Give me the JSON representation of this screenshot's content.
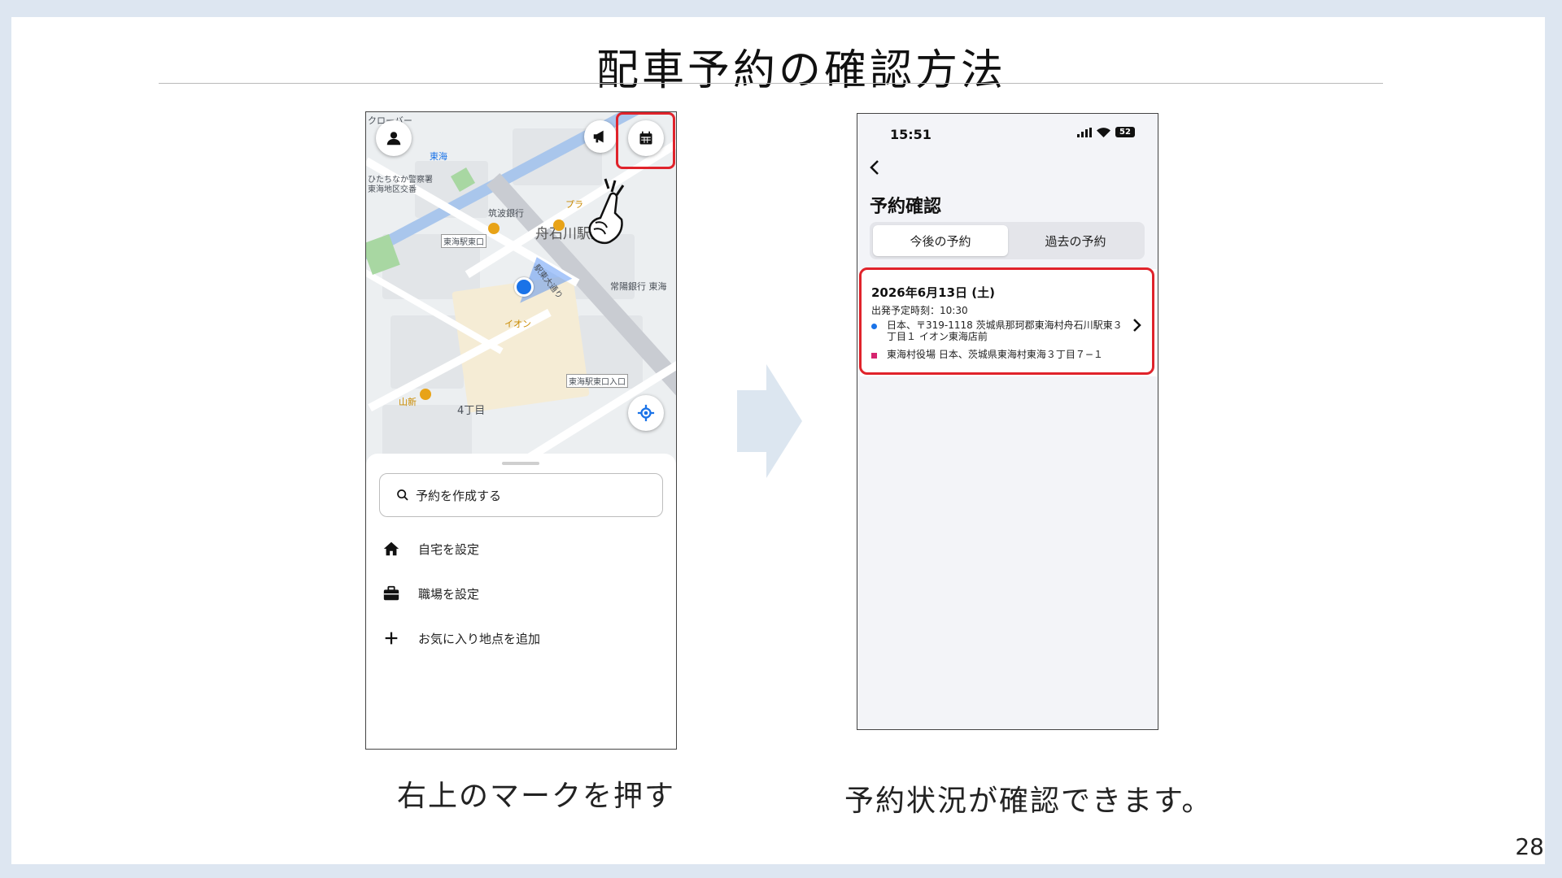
{
  "slide": {
    "title": "配車予約の確認方法",
    "page_number": "28",
    "caption_left": "右上のマークを押す",
    "caption_right": "予約状況が確認できます。"
  },
  "map_screen": {
    "map_labels": {
      "clover": "クローバー",
      "tokai_station": "東海",
      "police": "ひたちなか警察署\n東海地区交番",
      "tsukuba_bank": "筑波銀行",
      "fune": "舟石川駅東",
      "east_exit": "東海駅東口",
      "joyo_bank": "常陽銀行 東海",
      "aeon": "イオン",
      "east_exit_entrance": "東海駅東口入口",
      "yamashin": "山新",
      "chome4": "4丁目",
      "street": "駅東大通り",
      "pla": "プラ"
    },
    "search_placeholder": "予約を作成する",
    "menu": [
      {
        "icon": "home-icon",
        "label": "自宅を設定"
      },
      {
        "icon": "briefcase-icon",
        "label": "職場を設定"
      },
      {
        "icon": "plus-icon",
        "label": "お気に入り地点を追加"
      }
    ]
  },
  "reservation_screen": {
    "status_time": "15:51",
    "battery": "52",
    "title": "予約確認",
    "tabs": [
      "今後の予約",
      "過去の予約"
    ],
    "active_tab": "今後の予約",
    "reservation": {
      "date": "2026年6月13日 (土)",
      "departure": "出発予定時刻：10:30",
      "pickup": "日本、〒319-1118 茨城県那珂郡東海村舟石川駅東３丁目１ イオン東海店前",
      "dropoff": "東海村役場 日本、茨城県東海村東海３丁目７−１"
    }
  },
  "colors": {
    "highlight": "#e0232b",
    "accent_blue": "#1a73e8",
    "arrow": "#dce6f0",
    "background": "#dde6f1"
  }
}
